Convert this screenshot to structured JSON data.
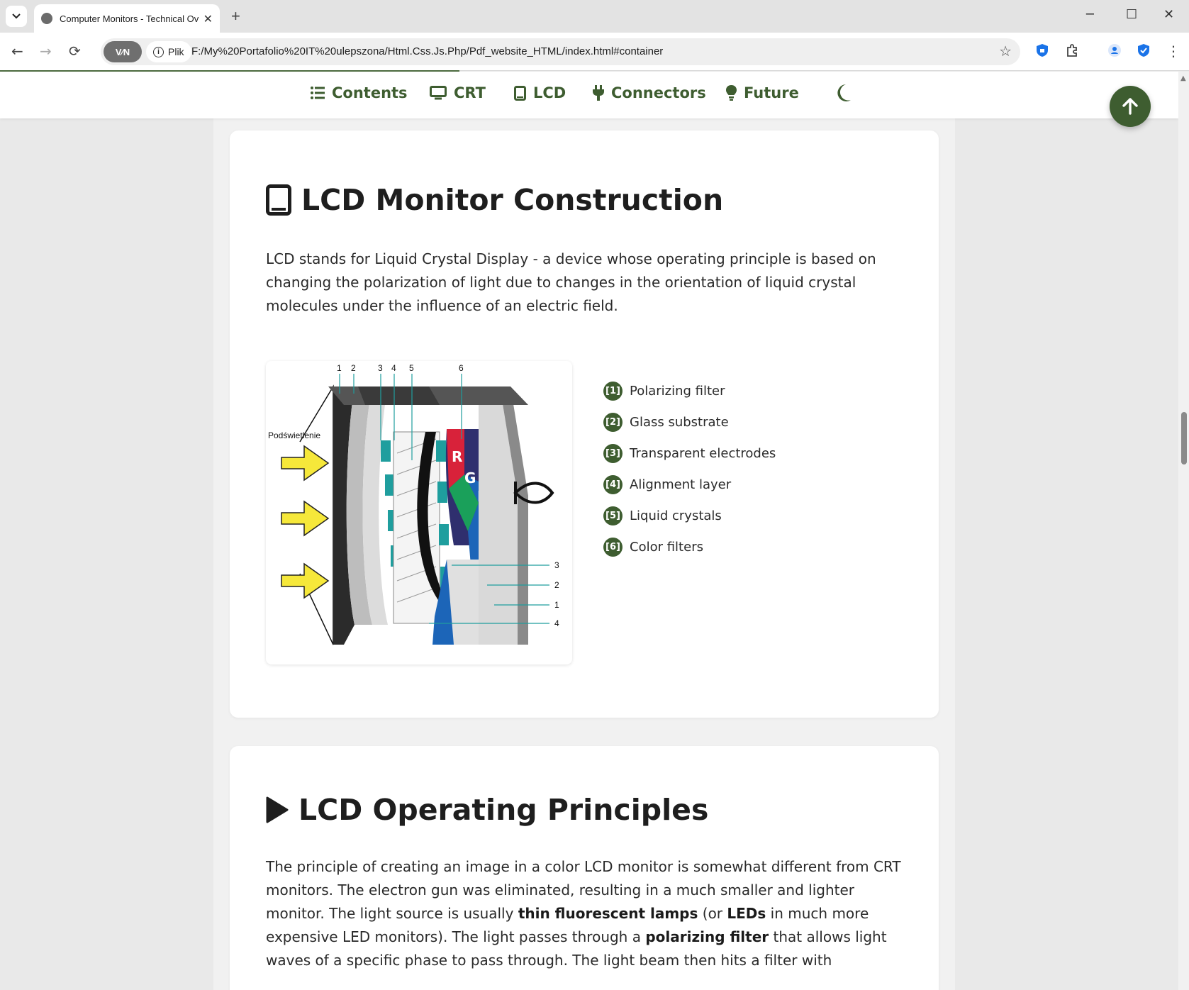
{
  "browser": {
    "tab_title": "Computer Monitors - Technical Ov",
    "url": "F:/My%20Portafolio%20IT%20ulepszona/Html.Css.Js.Php/Pdf_website_HTML/index.html#container",
    "vpn_label": "V∕N",
    "site_info_label": "Plik",
    "new_tab": "+",
    "minimize": "─",
    "maximize": "☐",
    "close": "✕"
  },
  "nav": {
    "items": [
      {
        "label": "Contents",
        "icon": "list-icon"
      },
      {
        "label": "CRT",
        "icon": "desktop-icon"
      },
      {
        "label": "LCD",
        "icon": "tablet-icon"
      },
      {
        "label": "Connectors",
        "icon": "plug-icon"
      },
      {
        "label": "Future",
        "icon": "lightbulb-icon"
      }
    ],
    "theme_toggle_icon": "moon-icon",
    "back_to_top_icon": "arrow-up-icon"
  },
  "section_construction": {
    "title": "LCD Monitor Construction",
    "icon": "tablet-icon",
    "text": "LCD stands for Liquid Crystal Display - a device whose operating principle is based on changing the polarization of light due to changes in the orientation of liquid crystal molecules under the influence of an electric field.",
    "diagram": {
      "backlight_label": "Podświetlenie",
      "top_numbers": [
        "1",
        "2",
        "3",
        "4",
        "5",
        "6"
      ],
      "side_numbers": [
        "3",
        "2",
        "1",
        "4"
      ],
      "rgb": [
        "R",
        "G",
        "B"
      ]
    },
    "legend": [
      {
        "num": "[1]",
        "label": "Polarizing filter"
      },
      {
        "num": "[2]",
        "label": "Glass substrate"
      },
      {
        "num": "[3]",
        "label": "Transparent electrodes"
      },
      {
        "num": "[4]",
        "label": "Alignment layer"
      },
      {
        "num": "[5]",
        "label": "Liquid crystals"
      },
      {
        "num": "[6]",
        "label": "Color filters"
      }
    ]
  },
  "section_principles": {
    "title": "LCD Operating Principles",
    "icon": "play-icon",
    "p1": "The principle of creating an image in a color LCD monitor is somewhat different from CRT monitors. The electron gun was eliminated, resulting in a much smaller and lighter monitor. The light source is usually ",
    "b1": "thin fluorescent lamps",
    "p2": " (or ",
    "b2": "LEDs",
    "p3": " in much more expensive LED monitors). The light passes through a ",
    "b3": "polarizing filter",
    "p4": " that allows light waves of a specific phase to pass through. The light beam then hits a filter with"
  },
  "colors": {
    "accent": "#3e5d30",
    "page_bg": "#e9e9e9",
    "card_bg": "#ffffff",
    "text": "#1e1e1e"
  }
}
